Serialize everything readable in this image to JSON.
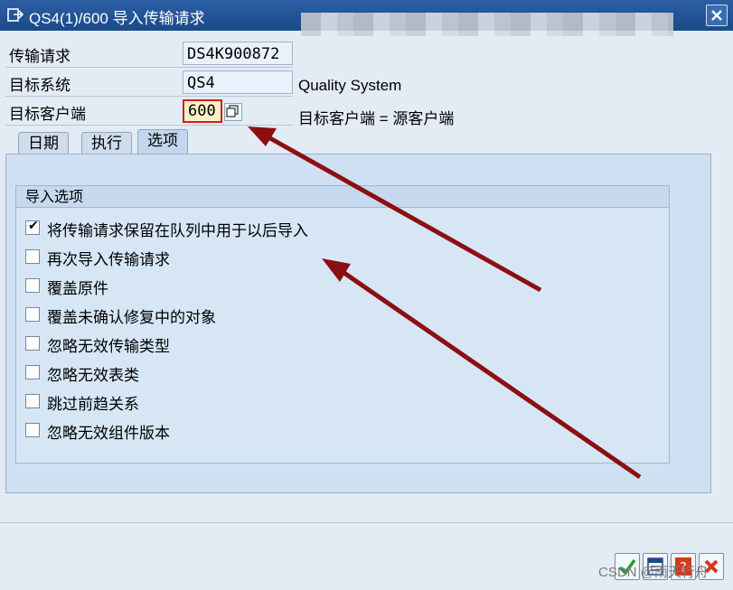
{
  "window": {
    "title": "QS4(1)/600 导入传输请求",
    "close_icon": "close-icon"
  },
  "form": {
    "transport_request_label": "传输请求",
    "transport_request_value": "DS4K900872",
    "target_system_label": "目标系统",
    "target_system_value": "QS4",
    "target_system_desc": "Quality System",
    "target_client_label": "目标客户端",
    "target_client_value": "600",
    "target_client_desc": "目标客户端 = 源客户端"
  },
  "tabs": [
    {
      "label": "日期"
    },
    {
      "label": "执行"
    },
    {
      "label": "选项",
      "active": true
    }
  ],
  "options_group": {
    "title": "导入选项",
    "items": [
      {
        "label": "将传输请求保留在队列中用于以后导入",
        "checked": true
      },
      {
        "label": "再次导入传输请求",
        "checked": false
      },
      {
        "label": "覆盖原件",
        "checked": false
      },
      {
        "label": "覆盖未确认修复中的对象",
        "checked": false
      },
      {
        "label": "忽略无效传输类型",
        "checked": false
      },
      {
        "label": "忽略无效表类",
        "checked": false
      },
      {
        "label": "跳过前趋关系",
        "checked": false
      },
      {
        "label": "忽略无效组件版本",
        "checked": false
      }
    ]
  },
  "watermark": "CSDN @雨天行舟",
  "colors": {
    "title_bar": "#1b4a8a",
    "arrow": "#8b0f12",
    "field_focus": "#cf1f1f"
  }
}
